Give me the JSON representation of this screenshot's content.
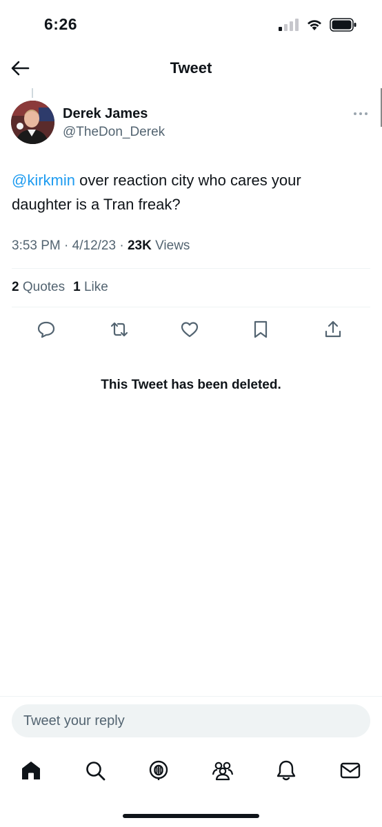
{
  "status_bar": {
    "time": "6:26"
  },
  "header": {
    "title": "Tweet"
  },
  "author": {
    "name": "Derek James",
    "handle": "@TheDon_Derek"
  },
  "tweet": {
    "mention": "@kirkmin",
    "body": " over reaction city who cares your daughter is a Tran freak?",
    "time": "3:53 PM",
    "date": "4/12/23",
    "views_count": "23K",
    "views_label": "Views",
    "quotes_count": "2",
    "quotes_label": "Quotes",
    "likes_count": "1",
    "likes_label": "Like"
  },
  "quoted_tweet": {
    "notice": "This Tweet has been deleted."
  },
  "reply": {
    "placeholder": "Tweet your reply"
  },
  "tabs": [
    "home-icon",
    "search-icon",
    "spaces-icon",
    "communities-icon",
    "notifications-icon",
    "messages-icon"
  ],
  "colors": {
    "accent": "#1d9bf0",
    "text": "#0f1419",
    "secondary": "#536471"
  }
}
